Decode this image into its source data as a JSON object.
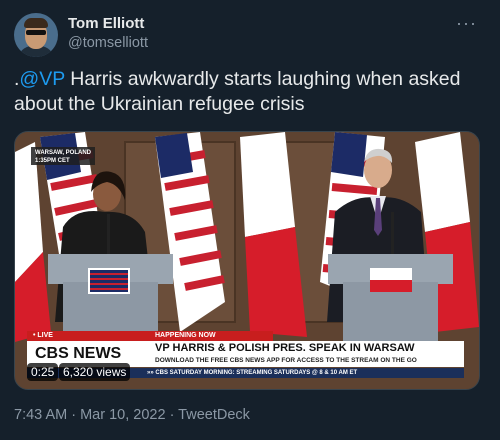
{
  "author": {
    "name": "Tom Elliott",
    "handle": "@tomselliott"
  },
  "tweet": {
    "prefix": ".",
    "mention": "@VP",
    "text": " Harris awkwardly starts laughing when asked about the Ukrainian refugee crisis"
  },
  "video": {
    "dateline_location": "WARSAW, POLAND",
    "dateline_time": "1:35PM CET",
    "live_label": "• LIVE",
    "happening_label": "HAPPENING NOW",
    "network_logo": "CBS NEWS",
    "headline": "VP HARRIS & POLISH PRES. SPEAK IN WARSAW",
    "subline": "DOWNLOAD THE FREE CBS NEWS APP FOR ACCESS TO THE STREAM ON THE GO",
    "ticker": "»» CBS SATURDAY MORNING: STREAMING SATURDAYS @ 8 & 10 AM ET",
    "duration": "0:25",
    "views": "6,320 views"
  },
  "meta": {
    "time": "7:43 AM",
    "separator": " · ",
    "date": "Mar 10, 2022",
    "source": "TweetDeck"
  },
  "menu": {
    "more_label": "···"
  },
  "colors": {
    "background": "#15202b",
    "accent": "#1d9bf0",
    "secondary_text": "#8b98a5",
    "chyron_red": "#c81e1e"
  }
}
